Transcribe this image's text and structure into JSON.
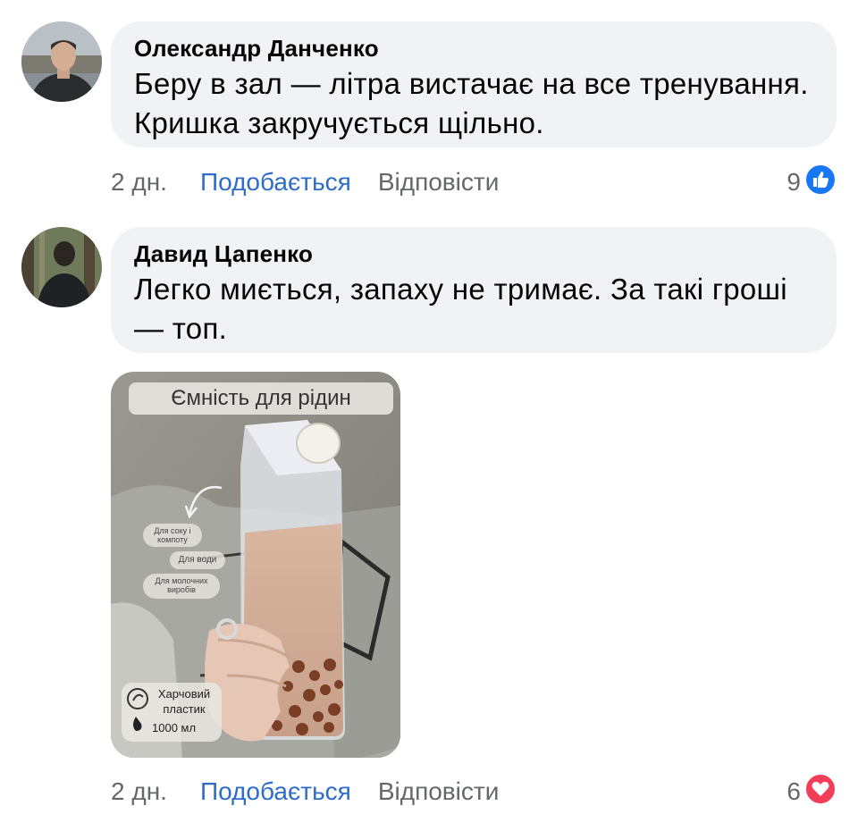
{
  "comments": [
    {
      "author": "Олександр Данченко",
      "text": "Беру в зал — літра вистачає на все тренування. Кришка закручується щільно.",
      "time": "2 дн.",
      "like_label": "Подобається",
      "reply_label": "Відповісти",
      "reaction_count": "9",
      "reaction_icon": "like-icon",
      "reaction_color": "#1877f2"
    },
    {
      "author": "Давид Цапенко",
      "text": "Легко миється, запаху не тримає. За такі гроші — топ.",
      "time": "2 дн.",
      "like_label": "Подобається",
      "reply_label": "Відповісти",
      "reaction_count": "6",
      "reaction_icon": "love-icon",
      "reaction_color": "#f33e58"
    }
  ],
  "photo": {
    "banner": "Ємність для рідин",
    "tags": [
      "Для соку і компоту",
      "Для води",
      "Для молочних виробів"
    ],
    "material": "Харчовий пластик",
    "volume": "1000 мл"
  }
}
